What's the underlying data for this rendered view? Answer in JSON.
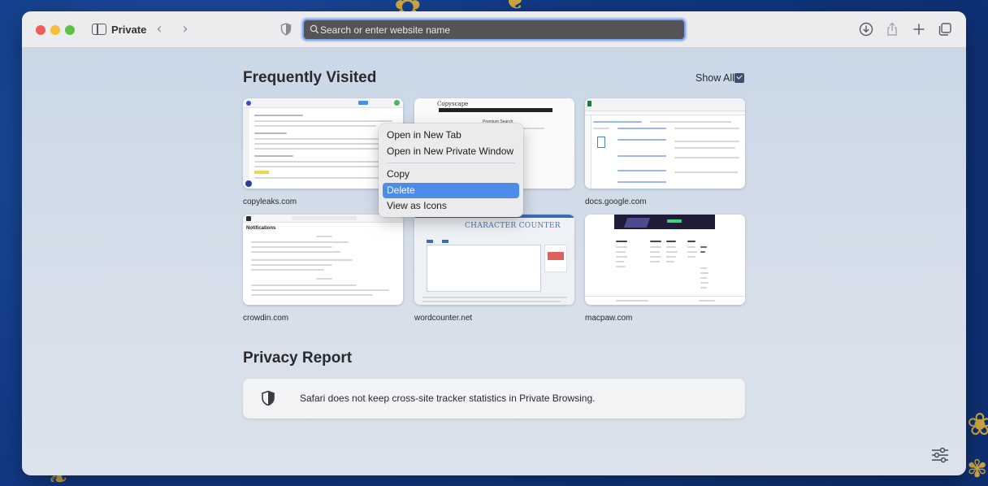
{
  "toolbar": {
    "mode_label": "Private",
    "address_placeholder": "Search or enter website name"
  },
  "frequently_visited": {
    "title": "Frequently Visited",
    "show_all_label": "Show All",
    "tiles": [
      {
        "label": "copyleaks.com"
      },
      {
        "label": ""
      },
      {
        "label": "docs.google.com"
      },
      {
        "label": "crowdin.com"
      },
      {
        "label": "wordcounter.net"
      },
      {
        "label": "macpaw.com"
      }
    ],
    "thumb_text": {
      "copyscape": "Copyscape",
      "premium_search": "Premium Search",
      "notifications": "Notifications",
      "character_counter": "CHARACTER COUNTER"
    }
  },
  "context_menu": {
    "items": [
      "Open in New Tab",
      "Open in New Private Window",
      "Copy",
      "Delete",
      "View as Icons"
    ],
    "highlighted": "Delete"
  },
  "privacy_report": {
    "title": "Privacy Report",
    "message": "Safari does not keep cross-site tracker statistics in Private Browsing."
  }
}
